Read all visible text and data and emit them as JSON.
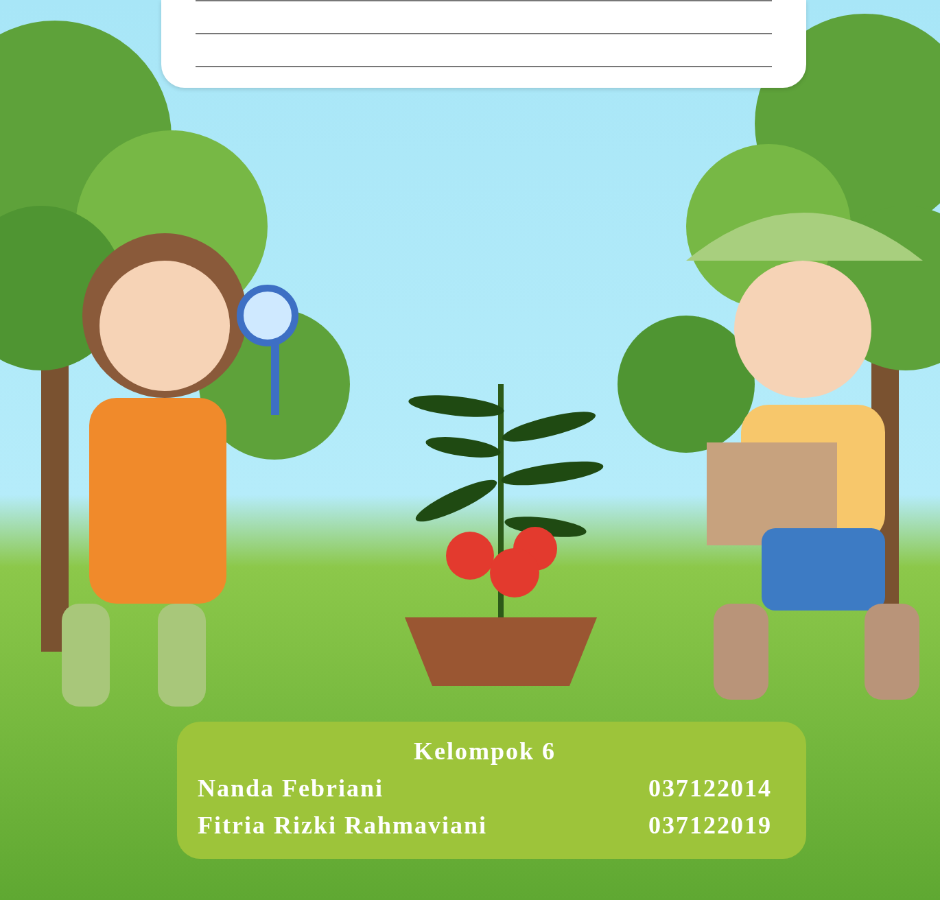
{
  "group_card": {
    "title": "Kelompok 6",
    "members": [
      {
        "name": "Nanda Febriani",
        "id": "037122014"
      },
      {
        "name": "Fitria Rizki Rahmaviani",
        "id": "037122019"
      }
    ]
  }
}
